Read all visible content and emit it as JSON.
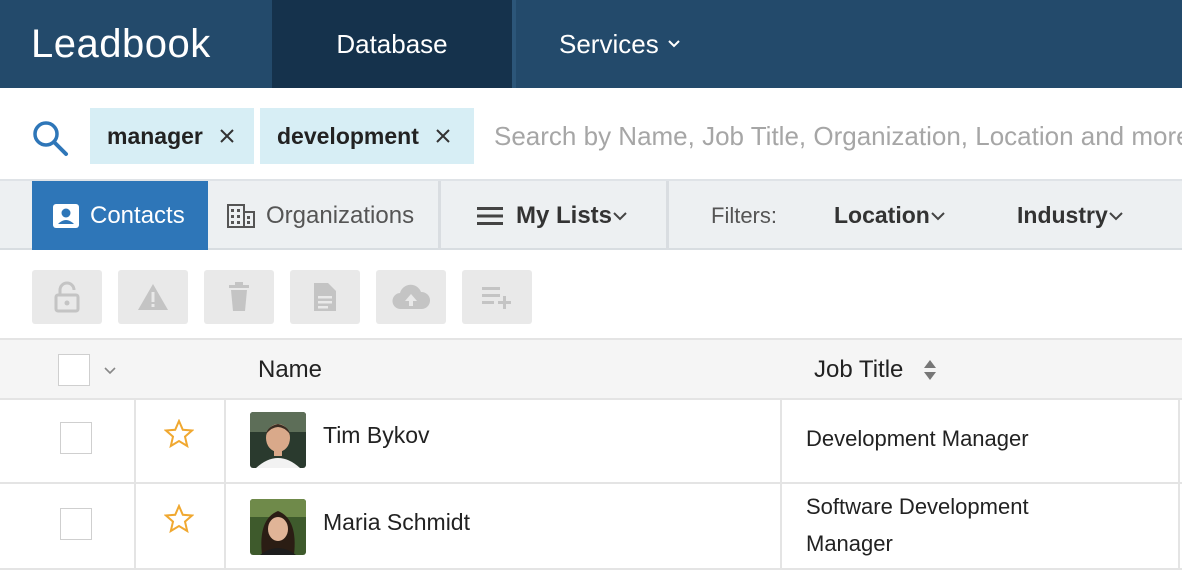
{
  "app": {
    "logo": "Leadbook"
  },
  "nav": {
    "database": "Database",
    "services": "Services"
  },
  "search": {
    "chips": [
      "manager",
      "development"
    ],
    "placeholder": "Search by Name, Job Title, Organization, Location and more"
  },
  "tabs": {
    "contacts": "Contacts",
    "organizations": "Organizations",
    "my_lists": "My Lists",
    "filters_label": "Filters:",
    "location": "Location",
    "industry": "Industry"
  },
  "toolbar": {
    "icons": [
      "unlock-icon",
      "warning-icon",
      "trash-icon",
      "document-icon",
      "cloud-upload-icon",
      "add-to-list-icon"
    ]
  },
  "table": {
    "columns": {
      "name": "Name",
      "job_title": "Job Title"
    },
    "rows": [
      {
        "name": "Tim Bykov",
        "job_title": "Development Manager",
        "starred": false
      },
      {
        "name": "Maria Schmidt",
        "job_title": "Software Development Manager",
        "starred": false
      }
    ]
  },
  "colors": {
    "nav_bg": "#234a6b",
    "nav_active": "#15324c",
    "chip_bg": "#d7eef5",
    "tab_active": "#2e76b8",
    "star": "#f0a830",
    "search_icon": "#2e76b8"
  }
}
